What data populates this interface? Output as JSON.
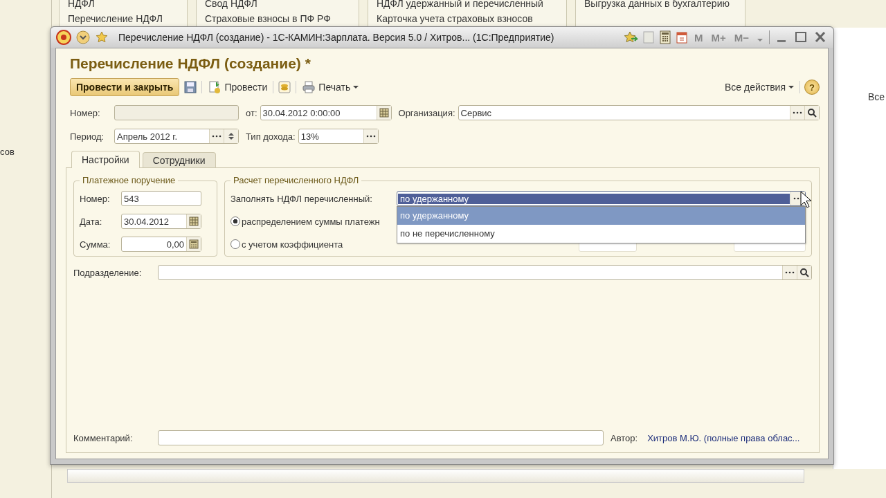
{
  "background": {
    "menu_columns": [
      {
        "items": [
          "НДФЛ",
          "Перечисление НДФЛ"
        ]
      },
      {
        "items": [
          "Свод НДФЛ",
          "Страховые взносы в ПФ РФ"
        ]
      },
      {
        "items": [
          "НДФЛ удержанный и перечисленный",
          "Карточка учета страховых взносов"
        ]
      },
      {
        "items": [
          "Выгрузка данных в бухгалтерию"
        ]
      }
    ],
    "left_text": "сов",
    "right_text": "Все"
  },
  "window": {
    "title": "Перечисление НДФЛ (создание) - 1С-КАМИН:Зарплата. Версия 5.0 / Хитров...  (1С:Предприятие)",
    "memory_buttons": [
      "M",
      "M+",
      "M−"
    ]
  },
  "form": {
    "heading": "Перечисление НДФЛ (создание) *",
    "toolbar": {
      "post_close": "Провести и закрыть",
      "post": "Провести",
      "print": "Печать",
      "all_actions": "Все действия",
      "help": "?"
    },
    "number": {
      "label": "Номер:"
    },
    "date": {
      "label": "от:",
      "value": "30.04.2012  0:00:00"
    },
    "organization": {
      "label": "Организация:",
      "value": "Сервис"
    },
    "period": {
      "label": "Период:",
      "value": "Апрель 2012 г."
    },
    "income_type": {
      "label": "Тип дохода:",
      "value": "13%"
    },
    "tabs": [
      {
        "label": "Настройки",
        "selected": true
      },
      {
        "label": "Сотрудники",
        "selected": false
      }
    ],
    "payment_order": {
      "title": "Платежное поручение",
      "number_label": "Номер:",
      "number": "543",
      "date_label": "Дата:",
      "date": "30.04.2012",
      "sum_label": "Сумма:",
      "sum": "0,00"
    },
    "calculation": {
      "title": "Расчет перечисленного НДФЛ",
      "fill_label": "Заполнять НДФЛ перечисленный:",
      "fill_value": "по удержанному",
      "options": [
        {
          "label": "по удержанному",
          "selected": true
        },
        {
          "label": "по не перечисленному",
          "selected": false
        }
      ],
      "radios": [
        {
          "label": "распределением суммы платежн",
          "selected": true
        },
        {
          "label": "с учетом коэффициента",
          "selected": false
        }
      ]
    },
    "department": {
      "label": "Подразделение:"
    },
    "comment": {
      "label": "Комментарий:"
    },
    "author": {
      "label": "Автор:",
      "value": "Хитров М.Ю. (полные права облас..."
    }
  }
}
